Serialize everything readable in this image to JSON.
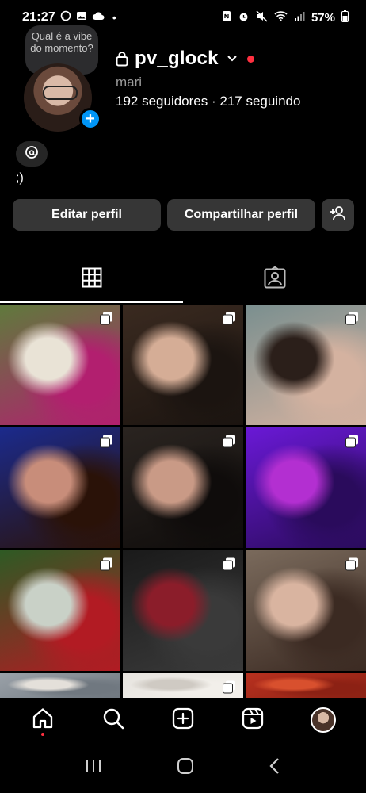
{
  "status_bar": {
    "time": "21:27",
    "battery": "57%"
  },
  "profile": {
    "note_text": "Qual é a vibe do momento?",
    "username": "pv_glock",
    "display_name": "mari",
    "stats": "192 seguidores · 217 seguindo",
    "bio": ";)"
  },
  "buttons": {
    "edit_label": "Editar perfil",
    "share_label": "Compartilhar perfil"
  },
  "tabs": [
    {
      "icon": "grid-icon",
      "active": true
    },
    {
      "icon": "tagged-icon",
      "active": false
    }
  ],
  "grid": {
    "posts": [
      {
        "colors": [
          "#5f7a3c",
          "#e9e3d6",
          "#b21f6f"
        ],
        "multi": true
      },
      {
        "colors": [
          "#3a2a20",
          "#d5ad96",
          "#1b1410"
        ],
        "multi": true
      },
      {
        "colors": [
          "#7a8f8f",
          "#2b1f1a",
          "#d4b2a0"
        ],
        "multi": true
      },
      {
        "colors": [
          "#1b2a8c",
          "#c88d7a",
          "#2a1208"
        ],
        "multi": true
      },
      {
        "colors": [
          "#2a2420",
          "#c99a86",
          "#0f0c0b"
        ],
        "multi": true
      },
      {
        "colors": [
          "#6a19d6",
          "#b32fd1",
          "#2a0b5c"
        ],
        "multi": true
      },
      {
        "colors": [
          "#2e5a24",
          "#c9d1c7",
          "#b21b23"
        ],
        "multi": true
      },
      {
        "colors": [
          "#1a1a1a",
          "#8b1d2a",
          "#3a3a3a"
        ],
        "multi": true
      },
      {
        "colors": [
          "#7a6a5c",
          "#d9b4a0",
          "#3b2a22"
        ],
        "multi": true
      },
      {
        "colors": [
          "#9aa1a8",
          "#e4e0da",
          "#707880"
        ],
        "multi": false
      },
      {
        "colors": [
          "#e7e4df",
          "#cfcac3",
          "#f2efea"
        ],
        "multi": true
      },
      {
        "colors": [
          "#b8311f",
          "#d8502e",
          "#8c2114"
        ],
        "multi": false
      }
    ]
  },
  "bottom_nav": [
    "home-icon",
    "search-icon",
    "create-post-icon",
    "reels-icon",
    "profile-avatar"
  ],
  "system_nav": [
    "recents-icon",
    "home-button-icon",
    "back-icon"
  ]
}
